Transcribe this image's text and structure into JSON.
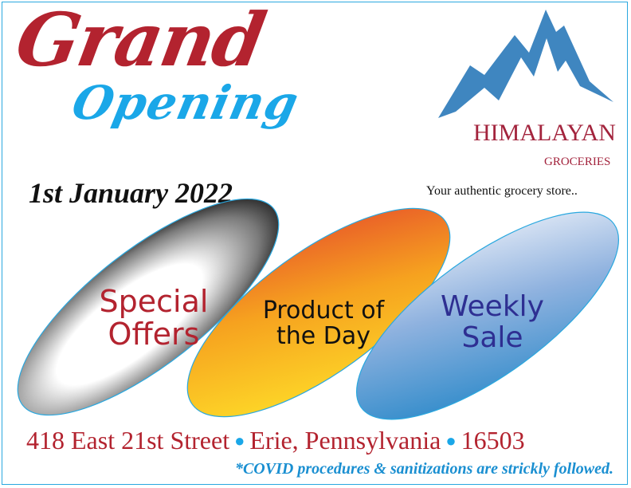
{
  "headline": {
    "grand": "Grand",
    "opening": "Opening",
    "date": "1st January 2022"
  },
  "brand": {
    "name": "HIMALAYAN",
    "subname": "GROCERIES",
    "tagline": "Your authentic grocery store..",
    "logo_icon": "mountain-logo",
    "colors": {
      "mountain": "#3f86c0",
      "name": "#a3243d"
    }
  },
  "features": [
    {
      "line1": "Special",
      "line2": "Offers"
    },
    {
      "line1": "Product of",
      "line2": "the Day"
    },
    {
      "line1": "Weekly",
      "line2": "Sale"
    }
  ],
  "address": {
    "street": "418 East 21st Street",
    "city": "Erie, Pennsylvania",
    "zip": "16503",
    "separator": "●"
  },
  "notice": "*COVID procedures & sanitizations are strickly followed.",
  "colors": {
    "red": "#b3232f",
    "blue": "#1aa7e8",
    "navy": "#2e2f92"
  }
}
